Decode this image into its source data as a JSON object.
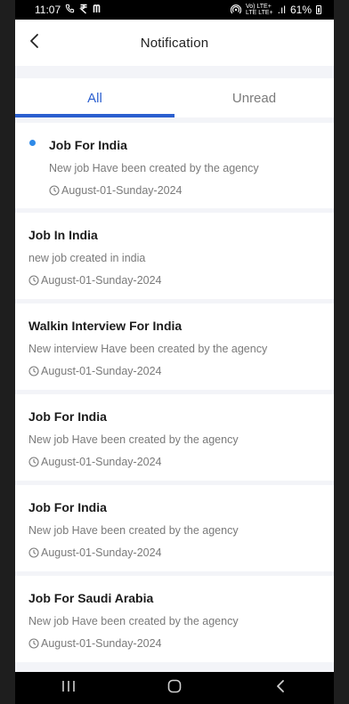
{
  "status_bar": {
    "time": "11:07",
    "left_icons": [
      "call-icon",
      "rupee-icon",
      "m-app-icon"
    ],
    "network_top": "Vo) LTE+",
    "network_bottom": "LTE LTE+",
    "signal": ".ıl",
    "battery": "61%"
  },
  "header": {
    "title": "Notification",
    "back_icon": "chevron-left-icon"
  },
  "tabs": [
    {
      "label": "All",
      "active": true
    },
    {
      "label": "Unread",
      "active": false
    }
  ],
  "notifications": [
    {
      "title": "Job For India",
      "description": "New job Have been created by the agency",
      "time": "August-01-Sunday-2024",
      "unread": true
    },
    {
      "title": "Job In India",
      "description": "new job created in india",
      "time": "August-01-Sunday-2024",
      "unread": false
    },
    {
      "title": "Walkin Interview For India",
      "description": "New interview Have been created by the agency",
      "time": "August-01-Sunday-2024",
      "unread": false
    },
    {
      "title": "Job For India",
      "description": "New job Have been created by the agency",
      "time": "August-01-Sunday-2024",
      "unread": false
    },
    {
      "title": "Job For India",
      "description": "New job Have been created by the agency",
      "time": "August-01-Sunday-2024",
      "unread": false
    },
    {
      "title": "Job For Saudi Arabia",
      "description": "New job Have been created by the agency",
      "time": "August-01-Sunday-2024",
      "unread": false
    }
  ],
  "nav_bar": [
    "recent-apps-icon",
    "home-icon",
    "back-icon"
  ],
  "colors": {
    "accent": "#2b5fcf",
    "unread_dot": "#2f8ae8",
    "background": "#f3f4f8"
  }
}
